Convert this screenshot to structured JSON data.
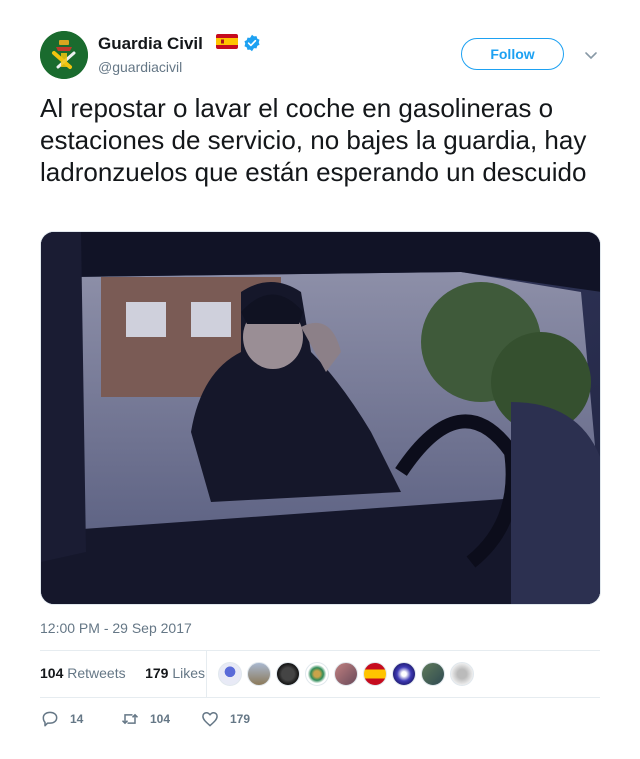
{
  "account": {
    "name": "Guardia Civil",
    "handle": "@guardiacivil",
    "follow_label": "Follow",
    "verified": true
  },
  "tweet": {
    "text": "Al repostar o lavar el coche en gasolineras o estaciones de servicio, no bajes la guardia, hay ladronzuelos que están esperando un descuido",
    "timestamp": "12:00 PM - 29 Sep 2017"
  },
  "stats": {
    "retweets_count": "104",
    "retweets_label": "Retweets",
    "likes_count": "179",
    "likes_label": "Likes"
  },
  "actions": {
    "reply_count": "14",
    "retweet_count": "104",
    "like_count": "179"
  },
  "colors": {
    "brand_blue": "#1da1f2",
    "secondary_text": "#657786",
    "guardia_green": "#1a6b2e"
  }
}
